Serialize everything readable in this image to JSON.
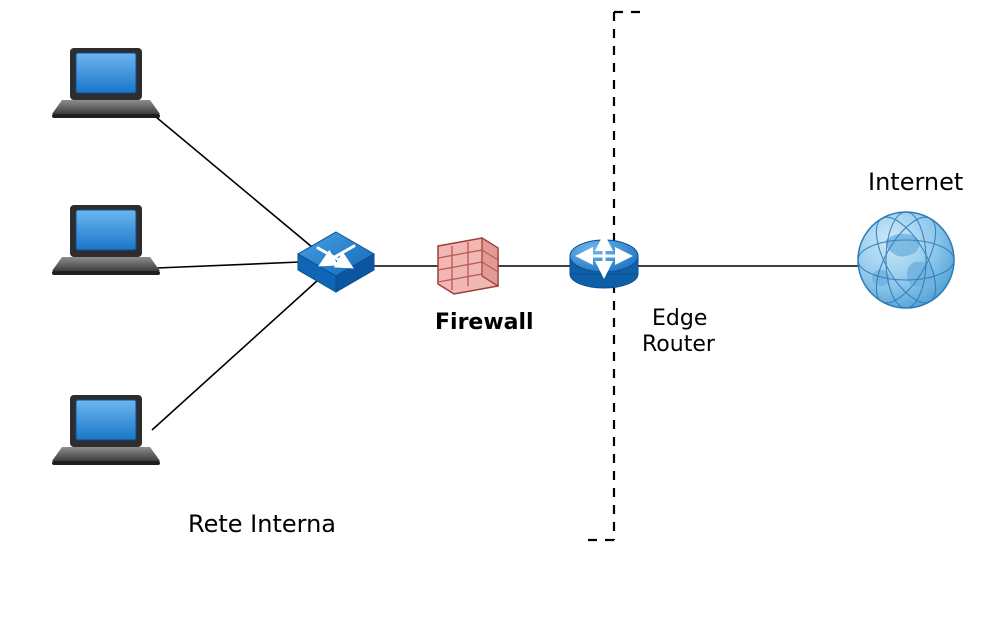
{
  "labels": {
    "firewall": "Firewall",
    "edge_router_l1": "Edge",
    "edge_router_l2": "Router",
    "internet": "Internet",
    "rete_interna": "Rete Interna"
  },
  "nodes": {
    "laptops": [
      "laptop-1",
      "laptop-2",
      "laptop-3"
    ],
    "switch": "switch",
    "firewall": "firewall",
    "router": "edge-router",
    "globe": "internet-globe"
  },
  "colors": {
    "device_blue": "#1f7bd1",
    "firewall_wall": "#f2b7b3",
    "globe_blue": "#8dc7ea"
  }
}
